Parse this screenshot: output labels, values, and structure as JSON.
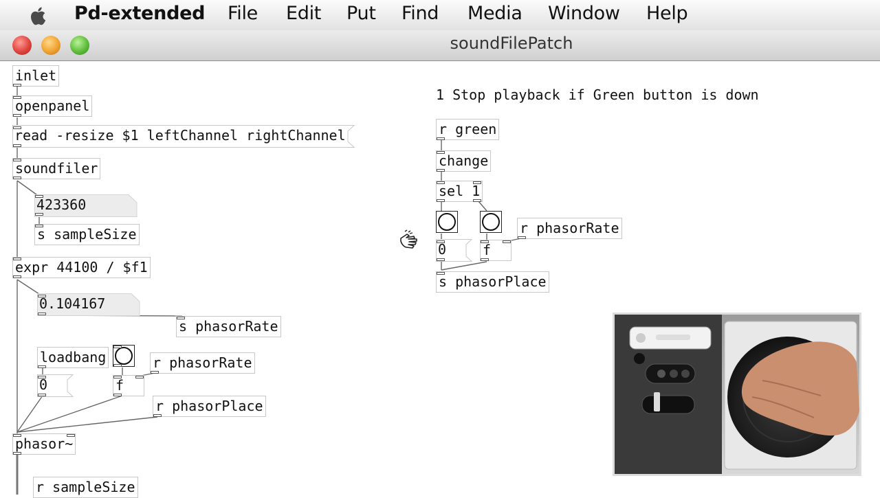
{
  "menubar": {
    "app_name": "Pd-extended",
    "items": [
      "File",
      "Edit",
      "Put",
      "Find",
      "Media",
      "Window",
      "Help"
    ]
  },
  "window": {
    "title": "soundFilePatch"
  },
  "patch": {
    "left": {
      "inlet": "inlet",
      "openpanel": "openpanel",
      "read_msg": "read -resize $1 leftChannel rightChannel",
      "soundfiler": "soundfiler",
      "number_samples": "423360",
      "send_sample_size": "s sampleSize",
      "expr": "expr 44100 / $f1",
      "number_rate": "0.104167",
      "send_phasor_rate": "s phasorRate",
      "loadbang": "loadbang",
      "msg_zero": "0",
      "float_obj": "f",
      "recv_phasor_rate": "r phasorRate",
      "recv_phasor_place": "r phasorPlace",
      "phasor": "phasor~",
      "recv_sample_size": "r sampleSize"
    },
    "right": {
      "comment": "1 Stop playback if Green button is down",
      "recv_green": "r green",
      "change": "change",
      "sel": "sel 1",
      "recv_phasor_rate": "r phasorRate",
      "msg_zero": "0",
      "float_obj": "f",
      "send_phasor_place": "s phasorPlace"
    }
  },
  "colors": {
    "close": "#e0443e",
    "minimize": "#f0a231",
    "zoom": "#5fbd3a"
  },
  "icons": [
    "apple-icon",
    "hand-cursor-icon"
  ]
}
